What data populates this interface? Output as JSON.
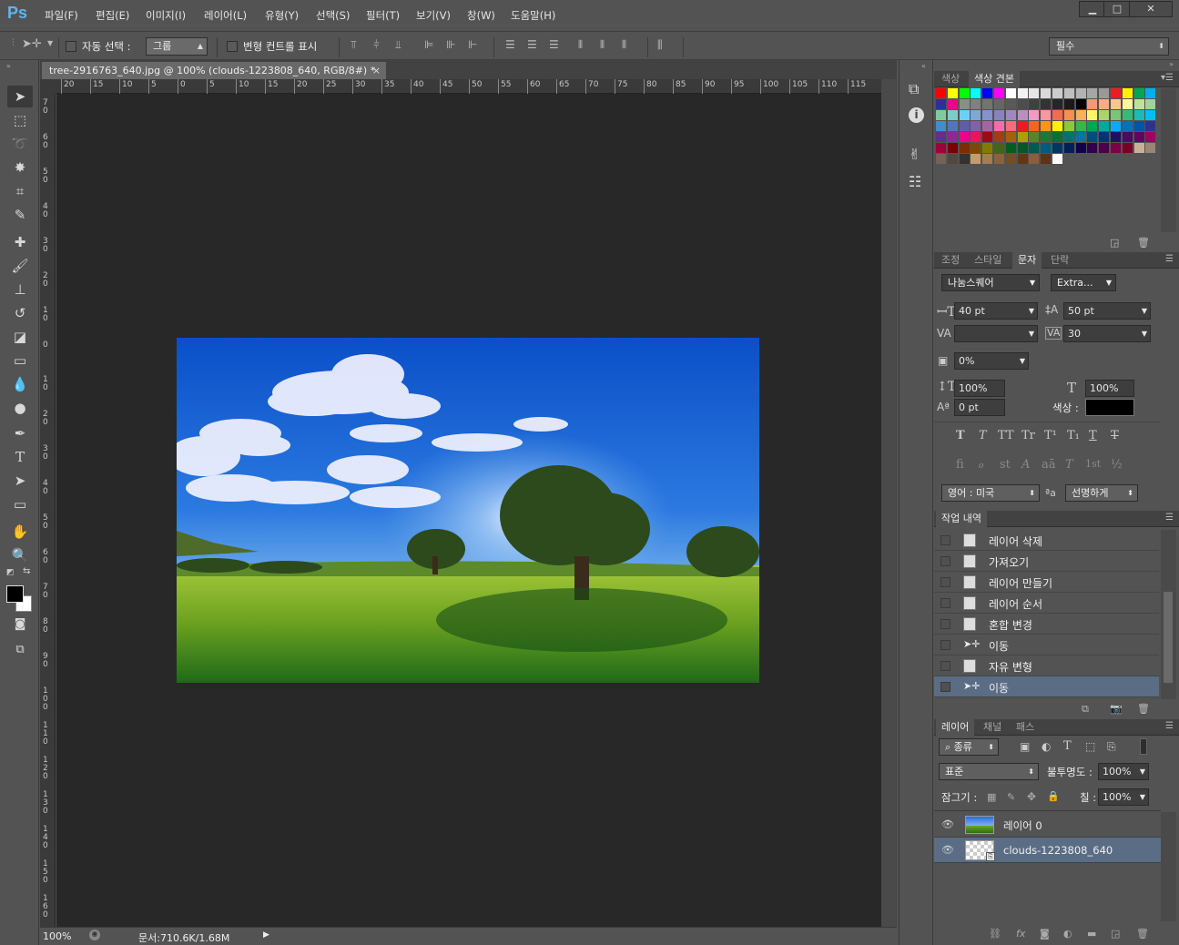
{
  "app": {
    "logo": "Ps"
  },
  "menu": [
    "파일(F)",
    "편집(E)",
    "이미지(I)",
    "레이어(L)",
    "유형(Y)",
    "선택(S)",
    "필터(T)",
    "보기(V)",
    "창(W)",
    "도움말(H)"
  ],
  "window_controls": {
    "minimize": "▁",
    "maximize": "□",
    "close": "✕"
  },
  "options": {
    "auto_select_label": "자동 선택 :",
    "auto_select_value": "그룹",
    "transform_controls_label": "변형 컨트롤 표시",
    "workspace": "필수"
  },
  "document": {
    "tab_title": "tree-2916763_640.jpg @ 100% (clouds-1223808_640, RGB/8#) *",
    "tab_close": "×",
    "hruler_labels": [
      "20",
      "15",
      "10",
      "5",
      "0",
      "5",
      "10",
      "15",
      "20",
      "25",
      "30",
      "35",
      "40",
      "45",
      "50",
      "55",
      "60",
      "65",
      "70",
      "75",
      "80",
      "85",
      "90",
      "95",
      "100",
      "105",
      "110",
      "115"
    ],
    "vruler_labels": [
      "70",
      "60",
      "50",
      "40",
      "30",
      "20",
      "10",
      "0",
      "10",
      "20",
      "30",
      "40",
      "50",
      "60",
      "70",
      "80",
      "90",
      "100",
      "110",
      "120",
      "130",
      "140",
      "150",
      "160"
    ],
    "zoom": "100%",
    "doc_info": "문서:710.6K/1.68M"
  },
  "swatches_panel": {
    "tabs": [
      "색상",
      "색상 견본"
    ],
    "active_tab": "색상 견본",
    "colors": [
      "#ff0000",
      "#ffff00",
      "#00ff00",
      "#00ffff",
      "#0000ff",
      "#ff00ff",
      "#ffffff",
      "#f2f2f2",
      "#e6e6e6",
      "#d9d9d9",
      "#cccccc",
      "#bfbfbf",
      "#b3b3b3",
      "#a6a6a6",
      "#999999",
      "#ed1c24",
      "#fff200",
      "#00a651",
      "#00aeef",
      "#2e3192",
      "#ec008c",
      "#8c8c8c",
      "#808080",
      "#737373",
      "#666666",
      "#595959",
      "#4d4d4d",
      "#404040",
      "#333333",
      "#262626",
      "#1a1a1a",
      "#000000",
      "#f7977a",
      "#f9ad81",
      "#fdc68a",
      "#fff79a",
      "#c4df9b",
      "#a3d39c",
      "#82ca9d",
      "#7bcdc8",
      "#6ecff6",
      "#7ea7d8",
      "#8493ca",
      "#8882be",
      "#a187be",
      "#bc8dbf",
      "#f49ac2",
      "#f6989d",
      "#f26c4f",
      "#f68e55",
      "#fbaf5c",
      "#fff467",
      "#acd372",
      "#7cc576",
      "#3bb878",
      "#1abbb4",
      "#00bff3",
      "#438cca",
      "#5574b9",
      "#605ca8",
      "#855fa8",
      "#a763a8",
      "#f06eaa",
      "#f26d7d",
      "#ed1c24",
      "#f26522",
      "#f7941d",
      "#fff200",
      "#8dc63f",
      "#39b54a",
      "#00a651",
      "#00a99d",
      "#00aeef",
      "#0072bc",
      "#0054a6",
      "#2e3192",
      "#662d91",
      "#92278f",
      "#ec008c",
      "#ed145b",
      "#9e0b0f",
      "#a0410d",
      "#a36209",
      "#aba000",
      "#598527",
      "#1a7b30",
      "#007236",
      "#00746b",
      "#0076a3",
      "#004b80",
      "#003471",
      "#1b1464",
      "#440e62",
      "#630460",
      "#9e005d",
      "#9e0039",
      "#790000",
      "#7b2e00",
      "#7d4900",
      "#827b00",
      "#406618",
      "#005e20",
      "#005826",
      "#005952",
      "#005b7f",
      "#003663",
      "#002157",
      "#0d004c",
      "#32004b",
      "#4b0049",
      "#7b0046",
      "#7a0026",
      "#c7b299",
      "#998675",
      "#736357",
      "#534741",
      "#37302d",
      "#c69c6d",
      "#a67c52",
      "#8c6239",
      "#754c24",
      "#603913",
      "#8b5e3c",
      "#5c3317",
      "#ffffff"
    ]
  },
  "char_panel": {
    "tabs": [
      "조정",
      "스타일",
      "문자",
      "단락"
    ],
    "active_tab": "문자",
    "font_family": "나눔스퀘어",
    "font_style": "Extra...",
    "size": "40 pt",
    "leading": "50 pt",
    "kerning": "",
    "tracking": "30",
    "scale_tsume": "0%",
    "vert_scale": "100%",
    "horiz_scale": "100%",
    "baseline": "0 pt",
    "color_label": "색상 :",
    "color": "#000000",
    "style_buttons": [
      "T",
      "T",
      "TT",
      "Tr",
      "T¹",
      "T₁",
      "T",
      "T"
    ],
    "opentype_buttons": [
      "fi",
      "ℴ",
      "st",
      "A",
      "aā",
      "T",
      "1st",
      "½"
    ],
    "language": "영어 : 미국",
    "aa_label": "ªa",
    "antialias": "선명하게"
  },
  "history_panel": {
    "title": "작업 내역",
    "items": [
      {
        "label": "레이어 삭제",
        "icon": "document-icon"
      },
      {
        "label": "가져오기",
        "icon": "document-icon"
      },
      {
        "label": "레이어 만들기",
        "icon": "document-icon"
      },
      {
        "label": "레이어 순서",
        "icon": "document-icon"
      },
      {
        "label": "혼합 변경",
        "icon": "document-icon"
      },
      {
        "label": "이동",
        "icon": "move-icon"
      },
      {
        "label": "자유 변형",
        "icon": "document-icon"
      },
      {
        "label": "이동",
        "icon": "move-icon"
      }
    ]
  },
  "layers_panel": {
    "tabs": [
      "레이어",
      "채널",
      "패스"
    ],
    "active_tab": "레이어",
    "filter_kind": "종류",
    "blend_mode": "표준",
    "opacity_label": "불투명도 :",
    "opacity": "100%",
    "lock_label": "잠그기 :",
    "fill_label": "칠 :",
    "fill": "100%",
    "layers": [
      {
        "name": "레이어 0",
        "visible": true,
        "selected": false
      },
      {
        "name": "clouds-1223808_640",
        "visible": true,
        "selected": true
      }
    ]
  }
}
